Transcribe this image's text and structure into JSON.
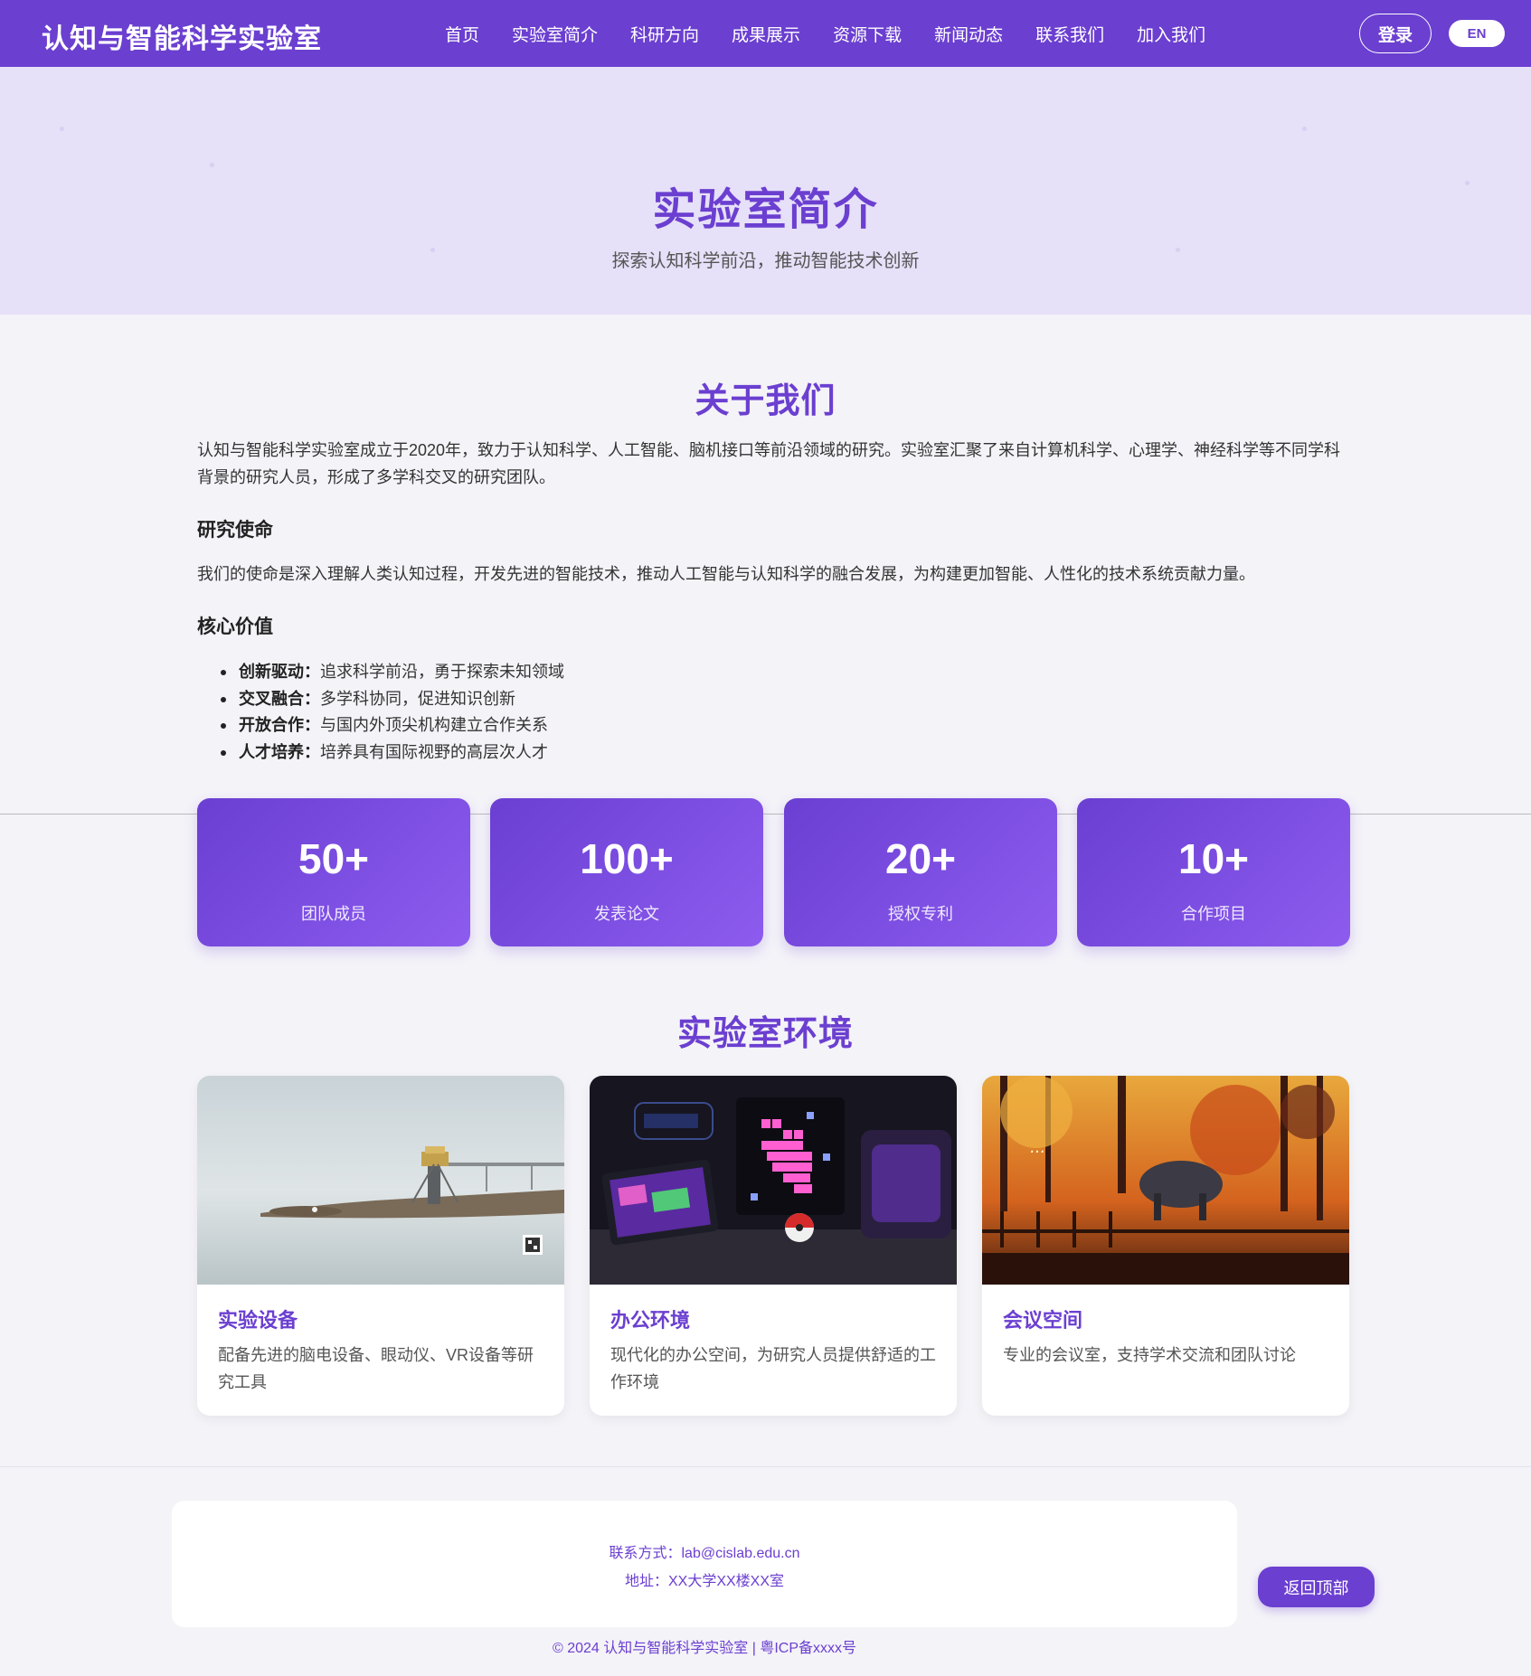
{
  "nav": {
    "brand": "认知与智能科学实验室",
    "links": [
      "首页",
      "实验室简介",
      "科研方向",
      "成果展示",
      "资源下载",
      "新闻动态",
      "联系我们",
      "加入我们"
    ],
    "login_label": "登录",
    "lang_label": "EN"
  },
  "hero": {
    "title": "实验室简介",
    "subtitle": "探索认知科学前沿，推动智能技术创新"
  },
  "about": {
    "title": "关于我们",
    "intro": "认知与智能科学实验室成立于2020年，致力于认知科学、人工智能、脑机接口等前沿领域的研究。实验室汇聚了来自计算机科学、心理学、神经科学等不同学科背景的研究人员，形成了多学科交叉的研究团队。",
    "mission_heading": "研究使命",
    "mission_text": "我们的使命是深入理解人类认知过程，开发先进的智能技术，推动人工智能与认知科学的融合发展，为构建更加智能、人性化的技术系统贡献力量。",
    "values_heading": "核心价值",
    "values": [
      {
        "term": "创新驱动：",
        "desc": "追求科学前沿，勇于探索未知领域"
      },
      {
        "term": "交叉融合：",
        "desc": "多学科协同，促进知识创新"
      },
      {
        "term": "开放合作：",
        "desc": "与国内外顶尖机构建立合作关系"
      },
      {
        "term": "人才培养：",
        "desc": "培养具有国际视野的高层次人才"
      }
    ]
  },
  "stats": [
    {
      "value": "50+",
      "label": "团队成员"
    },
    {
      "value": "100+",
      "label": "发表论文"
    },
    {
      "value": "20+",
      "label": "授权专利"
    },
    {
      "value": "10+",
      "label": "合作项目"
    }
  ],
  "environment": {
    "title": "实验室环境",
    "cards": [
      {
        "title": "实验设备",
        "desc": "配备先进的脑电设备、眼动仪、VR设备等研究工具"
      },
      {
        "title": "办公环境",
        "desc": "现代化的办公空间，为研究人员提供舒适的工作环境"
      },
      {
        "title": "会议空间",
        "desc": "专业的会议室，支持学术交流和团队讨论"
      }
    ]
  },
  "footer": {
    "contact": "联系方式：lab@cislab.edu.cn",
    "address": "地址：XX大学XX楼XX室",
    "copyright": "© 2024 认知与智能科学实验室 | 粤ICP备xxxx号",
    "back_to_top": "返回顶部"
  },
  "colors": {
    "primary": "#6b3fd0",
    "hero_bg": "#e6e0f8",
    "page_bg": "#f4f3f8"
  }
}
